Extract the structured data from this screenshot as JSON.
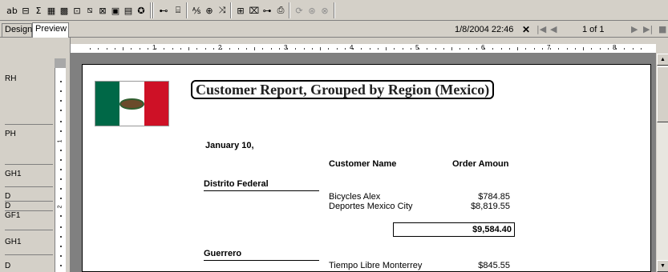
{
  "toolbar": {
    "buttons": [
      {
        "id": "tb-field-button",
        "glyph": "ab"
      },
      {
        "id": "tb-list-button",
        "glyph": "⊟"
      },
      {
        "id": "tb-sum-button",
        "glyph": "Σ"
      },
      {
        "id": "tb-grid-button",
        "glyph": "▦"
      },
      {
        "id": "tb-chart-button",
        "glyph": "▩"
      },
      {
        "id": "tb-ole-button",
        "glyph": "⊡"
      },
      {
        "id": "tb-line-button",
        "glyph": "⧅"
      },
      {
        "id": "tb-box-button",
        "glyph": "⊠"
      },
      {
        "id": "tb-image-button",
        "glyph": "▣"
      },
      {
        "id": "tb-map-button",
        "glyph": "▤"
      },
      {
        "id": "tb-globe-button",
        "glyph": "✪"
      }
    ],
    "buttons2": [
      {
        "id": "tb-link-button",
        "glyph": "⊷"
      },
      {
        "id": "tb-report-button",
        "glyph": "⌸"
      },
      {
        "id": "tb-format-button",
        "glyph": "⅍"
      },
      {
        "id": "tb-group-button",
        "glyph": "⊕"
      },
      {
        "id": "tb-sort-button",
        "glyph": "⤨"
      },
      {
        "id": "tb-select-button",
        "glyph": "⊞"
      },
      {
        "id": "tb-formula-button",
        "glyph": "⌧"
      },
      {
        "id": "tb-param-button",
        "glyph": "⊶"
      },
      {
        "id": "tb-export-button",
        "glyph": "⎙"
      },
      {
        "id": "tb-refresh-button",
        "glyph": "⟳"
      },
      {
        "id": "tb-help-button",
        "glyph": "⊛"
      },
      {
        "id": "tb-zoom-button",
        "glyph": "⊗"
      }
    ]
  },
  "tabs": {
    "design": "Design",
    "preview": "Preview"
  },
  "nav": {
    "timestamp": "1/8/2004 22:46",
    "close": "✕",
    "first": "|◀",
    "prev": "◀",
    "page_indicator": "1 of 1",
    "next": "▶",
    "last": "▶|",
    "stop": "■"
  },
  "sections": [
    "RH",
    "PH",
    "GH1",
    "D",
    "D",
    "GF1",
    "GH1",
    "D"
  ],
  "ruler": {
    "h_labels": [
      "1",
      "2",
      "3",
      "4",
      "5",
      "6",
      "7",
      "8"
    ],
    "v_labels": [
      "1",
      "2"
    ]
  },
  "report": {
    "title": "Customer Report, Grouped by Region (Mexico)",
    "date": "January 10,",
    "col_customer": "Customer Name",
    "col_amount": "Order Amoun",
    "groups": [
      {
        "name": "Distrito Federal",
        "rows": [
          {
            "customer": "Bicycles Alex",
            "amount": "$784.85"
          },
          {
            "customer": "Deportes Mexico City",
            "amount": "$8,819.55"
          }
        ],
        "total": "$9,584.40"
      },
      {
        "name": "Guerrero",
        "rows": [
          {
            "customer": "Tiempo Libre Monterrey",
            "amount": "$845.55"
          }
        ]
      }
    ],
    "flag_colors": [
      "#006847",
      "#ffffff",
      "#ce1126"
    ]
  }
}
